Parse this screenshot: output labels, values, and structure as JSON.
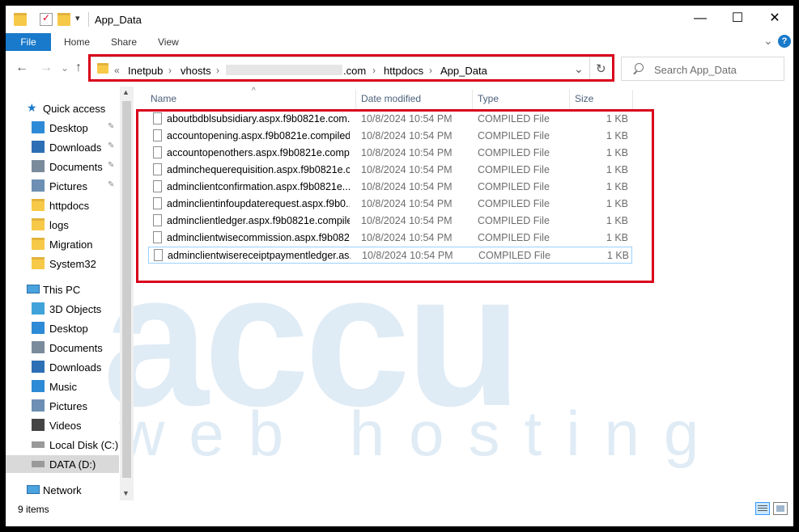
{
  "window": {
    "title": "App_Data",
    "minimize_glyph": "—",
    "maximize_glyph": "☐",
    "close_glyph": "✕",
    "help_glyph": "?",
    "expand_ribbon_glyph": "⌄"
  },
  "ribbon": {
    "tabs": [
      "File",
      "Home",
      "Share",
      "View"
    ]
  },
  "nav_buttons": {
    "back": "←",
    "forward": "→",
    "recent": "⌄",
    "up": "↑"
  },
  "address": {
    "overflow": "«",
    "crumbs": [
      "Inetpub",
      "vhosts",
      ".com",
      "httpdocs",
      "App_Data"
    ],
    "sep_glyph": "›",
    "dropdown_glyph": "⌄",
    "refresh_glyph": "↻"
  },
  "search": {
    "placeholder": "Search App_Data",
    "icon": "search-icon"
  },
  "nav_pane": {
    "quick_access": "Quick access",
    "quick_items": [
      {
        "label": "Desktop",
        "pinned": true,
        "icon": "desktop-icon"
      },
      {
        "label": "Downloads",
        "pinned": true,
        "icon": "downloads-icon"
      },
      {
        "label": "Documents",
        "pinned": true,
        "icon": "documents-icon"
      },
      {
        "label": "Pictures",
        "pinned": true,
        "icon": "pictures-icon"
      },
      {
        "label": "httpdocs",
        "pinned": false,
        "icon": "folder-icon"
      },
      {
        "label": "logs",
        "pinned": false,
        "icon": "folder-icon"
      },
      {
        "label": "Migration",
        "pinned": false,
        "icon": "folder-icon"
      },
      {
        "label": "System32",
        "pinned": false,
        "icon": "folder-icon"
      }
    ],
    "this_pc": "This PC",
    "pc_items": [
      {
        "label": "3D Objects",
        "icon": "3d-objects-icon"
      },
      {
        "label": "Desktop",
        "icon": "desktop-icon"
      },
      {
        "label": "Documents",
        "icon": "documents-icon"
      },
      {
        "label": "Downloads",
        "icon": "downloads-icon"
      },
      {
        "label": "Music",
        "icon": "music-icon"
      },
      {
        "label": "Pictures",
        "icon": "pictures-icon"
      },
      {
        "label": "Videos",
        "icon": "videos-icon"
      },
      {
        "label": "Local Disk (C:)",
        "icon": "drive-icon"
      },
      {
        "label": "DATA (D:)",
        "icon": "drive-icon",
        "selected": true
      }
    ],
    "network": "Network",
    "pin_glyph": "✎"
  },
  "file_list": {
    "columns": [
      "Name",
      "Date modified",
      "Type",
      "Size"
    ],
    "sort_glyph": "^",
    "rows": [
      {
        "name": "aboutbdblsubsidiary.aspx.f9b0821e.com...",
        "date": "10/8/2024 10:54 PM",
        "type": "COMPILED File",
        "size": "1 KB"
      },
      {
        "name": "accountopening.aspx.f9b0821e.compiled",
        "date": "10/8/2024 10:54 PM",
        "type": "COMPILED File",
        "size": "1 KB"
      },
      {
        "name": "accountopenothers.aspx.f9b0821e.compi...",
        "date": "10/8/2024 10:54 PM",
        "type": "COMPILED File",
        "size": "1 KB"
      },
      {
        "name": "adminchequerequisition.aspx.f9b0821e.c...",
        "date": "10/8/2024 10:54 PM",
        "type": "COMPILED File",
        "size": "1 KB"
      },
      {
        "name": "adminclientconfirmation.aspx.f9b0821e....",
        "date": "10/8/2024 10:54 PM",
        "type": "COMPILED File",
        "size": "1 KB"
      },
      {
        "name": "adminclientinfoupdaterequest.aspx.f9b0...",
        "date": "10/8/2024 10:54 PM",
        "type": "COMPILED File",
        "size": "1 KB"
      },
      {
        "name": "adminclientledger.aspx.f9b0821e.compiled",
        "date": "10/8/2024 10:54 PM",
        "type": "COMPILED File",
        "size": "1 KB"
      },
      {
        "name": "adminclientwisecommission.aspx.f9b082...",
        "date": "10/8/2024 10:54 PM",
        "type": "COMPILED File",
        "size": "1 KB"
      },
      {
        "name": "adminclientwisereceiptpaymentledger.as...",
        "date": "10/8/2024 10:54 PM",
        "type": "COMPILED File",
        "size": "1 KB"
      }
    ]
  },
  "status": {
    "item_count": "9 items"
  },
  "watermark": {
    "logo": "accu",
    "sub": "web hosting"
  },
  "colors": {
    "accent": "#1979ca",
    "highlight": "#d9001b",
    "watermark": "#4a8cc9"
  }
}
